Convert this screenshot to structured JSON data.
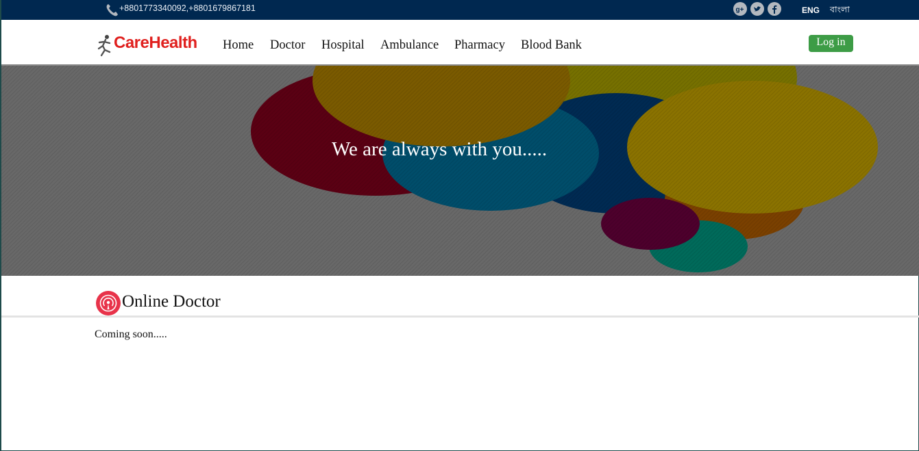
{
  "topbar": {
    "phone": "+8801773340092,+8801679867181",
    "social_icons": [
      "google-plus-icon",
      "twitter-icon",
      "facebook-icon"
    ],
    "lang_eng": "ENG",
    "lang_bn": "বাংলা"
  },
  "brand": {
    "name": "CareHealth",
    "color": "#e0201e"
  },
  "nav": {
    "items": [
      {
        "label": "Home"
      },
      {
        "label": "Doctor"
      },
      {
        "label": "Hospital"
      },
      {
        "label": "Ambulance"
      },
      {
        "label": "Pharmacy"
      },
      {
        "label": "Blood Bank"
      }
    ],
    "login_label": "Log in"
  },
  "hero": {
    "tagline": "We are always with you....."
  },
  "section": {
    "title": "Online Doctor",
    "body": "Coming soon....."
  },
  "colors": {
    "topbar": "#002850",
    "login": "#3d9c46",
    "section_icon": "#e8334a"
  }
}
